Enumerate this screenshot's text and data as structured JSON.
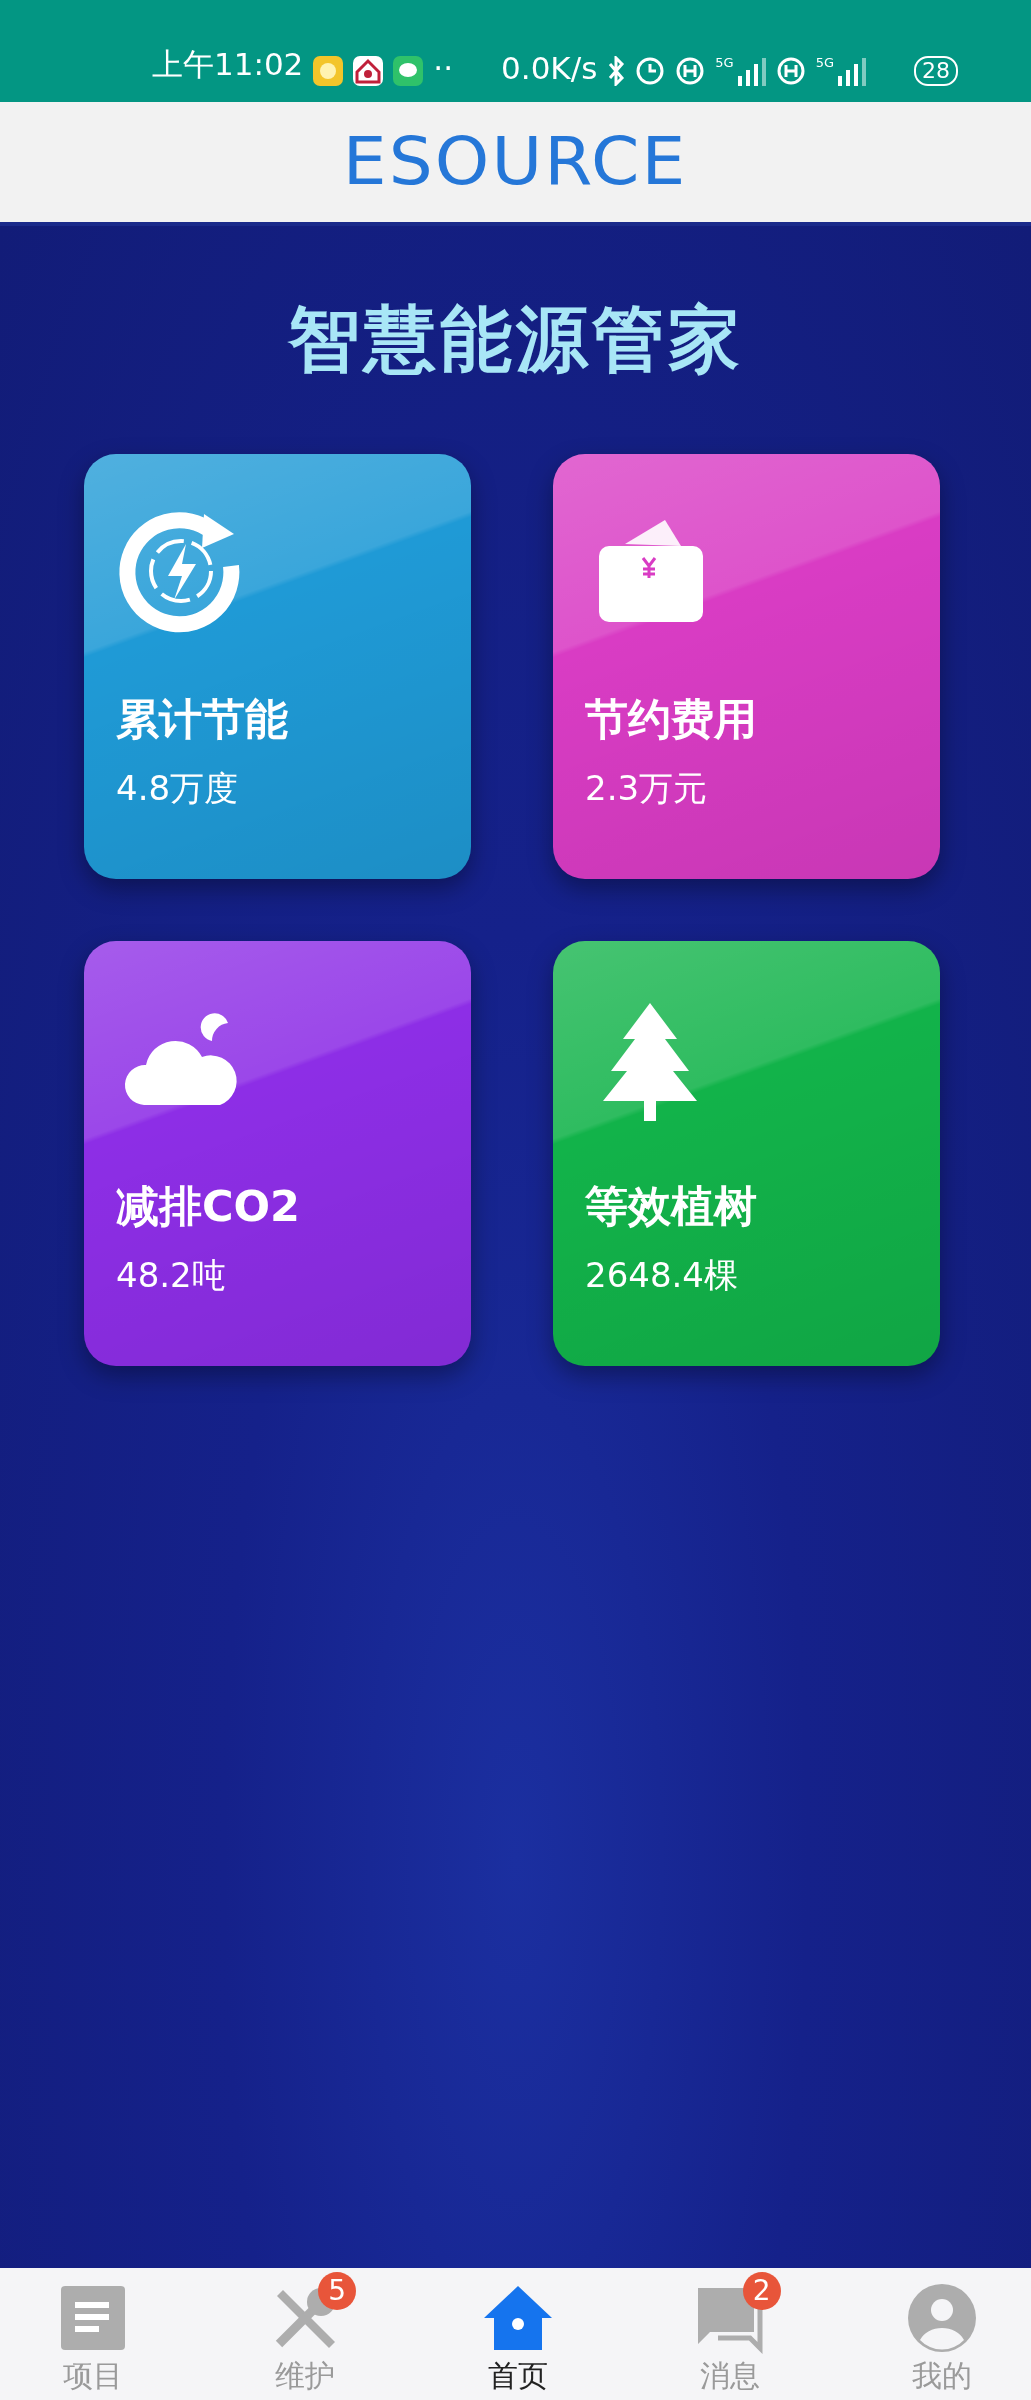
{
  "status_bar": {
    "time": "上午11:02",
    "dots": "··",
    "net_speed": "0.0K/s",
    "signals": [
      {
        "label": "5G"
      },
      {
        "label": "5G"
      }
    ],
    "battery": "28"
  },
  "header": {
    "logo": "ESOURCE"
  },
  "title": "智慧能源管家",
  "cards": [
    {
      "kind": "energy",
      "title": "累计节能",
      "value": "4.8万度",
      "color": "#1f9ad6"
    },
    {
      "kind": "money",
      "title": "节约费用",
      "value": "2.3万元",
      "color": "#d93cc4"
    },
    {
      "kind": "cloud",
      "title": "减排CO2",
      "value": "48.2吨",
      "color": "#8d2ee6"
    },
    {
      "kind": "tree",
      "title": "等效植树",
      "value": "2648.4棵",
      "color": "#12b34a"
    }
  ],
  "tabs": [
    {
      "kind": "project",
      "label": "项目",
      "selected": false
    },
    {
      "kind": "tools",
      "label": "维护",
      "selected": false,
      "badge": "5"
    },
    {
      "kind": "home",
      "label": "首页",
      "selected": true
    },
    {
      "kind": "message",
      "label": "消息",
      "selected": false,
      "badge": "2"
    },
    {
      "kind": "user",
      "label": "我的",
      "selected": false
    }
  ]
}
